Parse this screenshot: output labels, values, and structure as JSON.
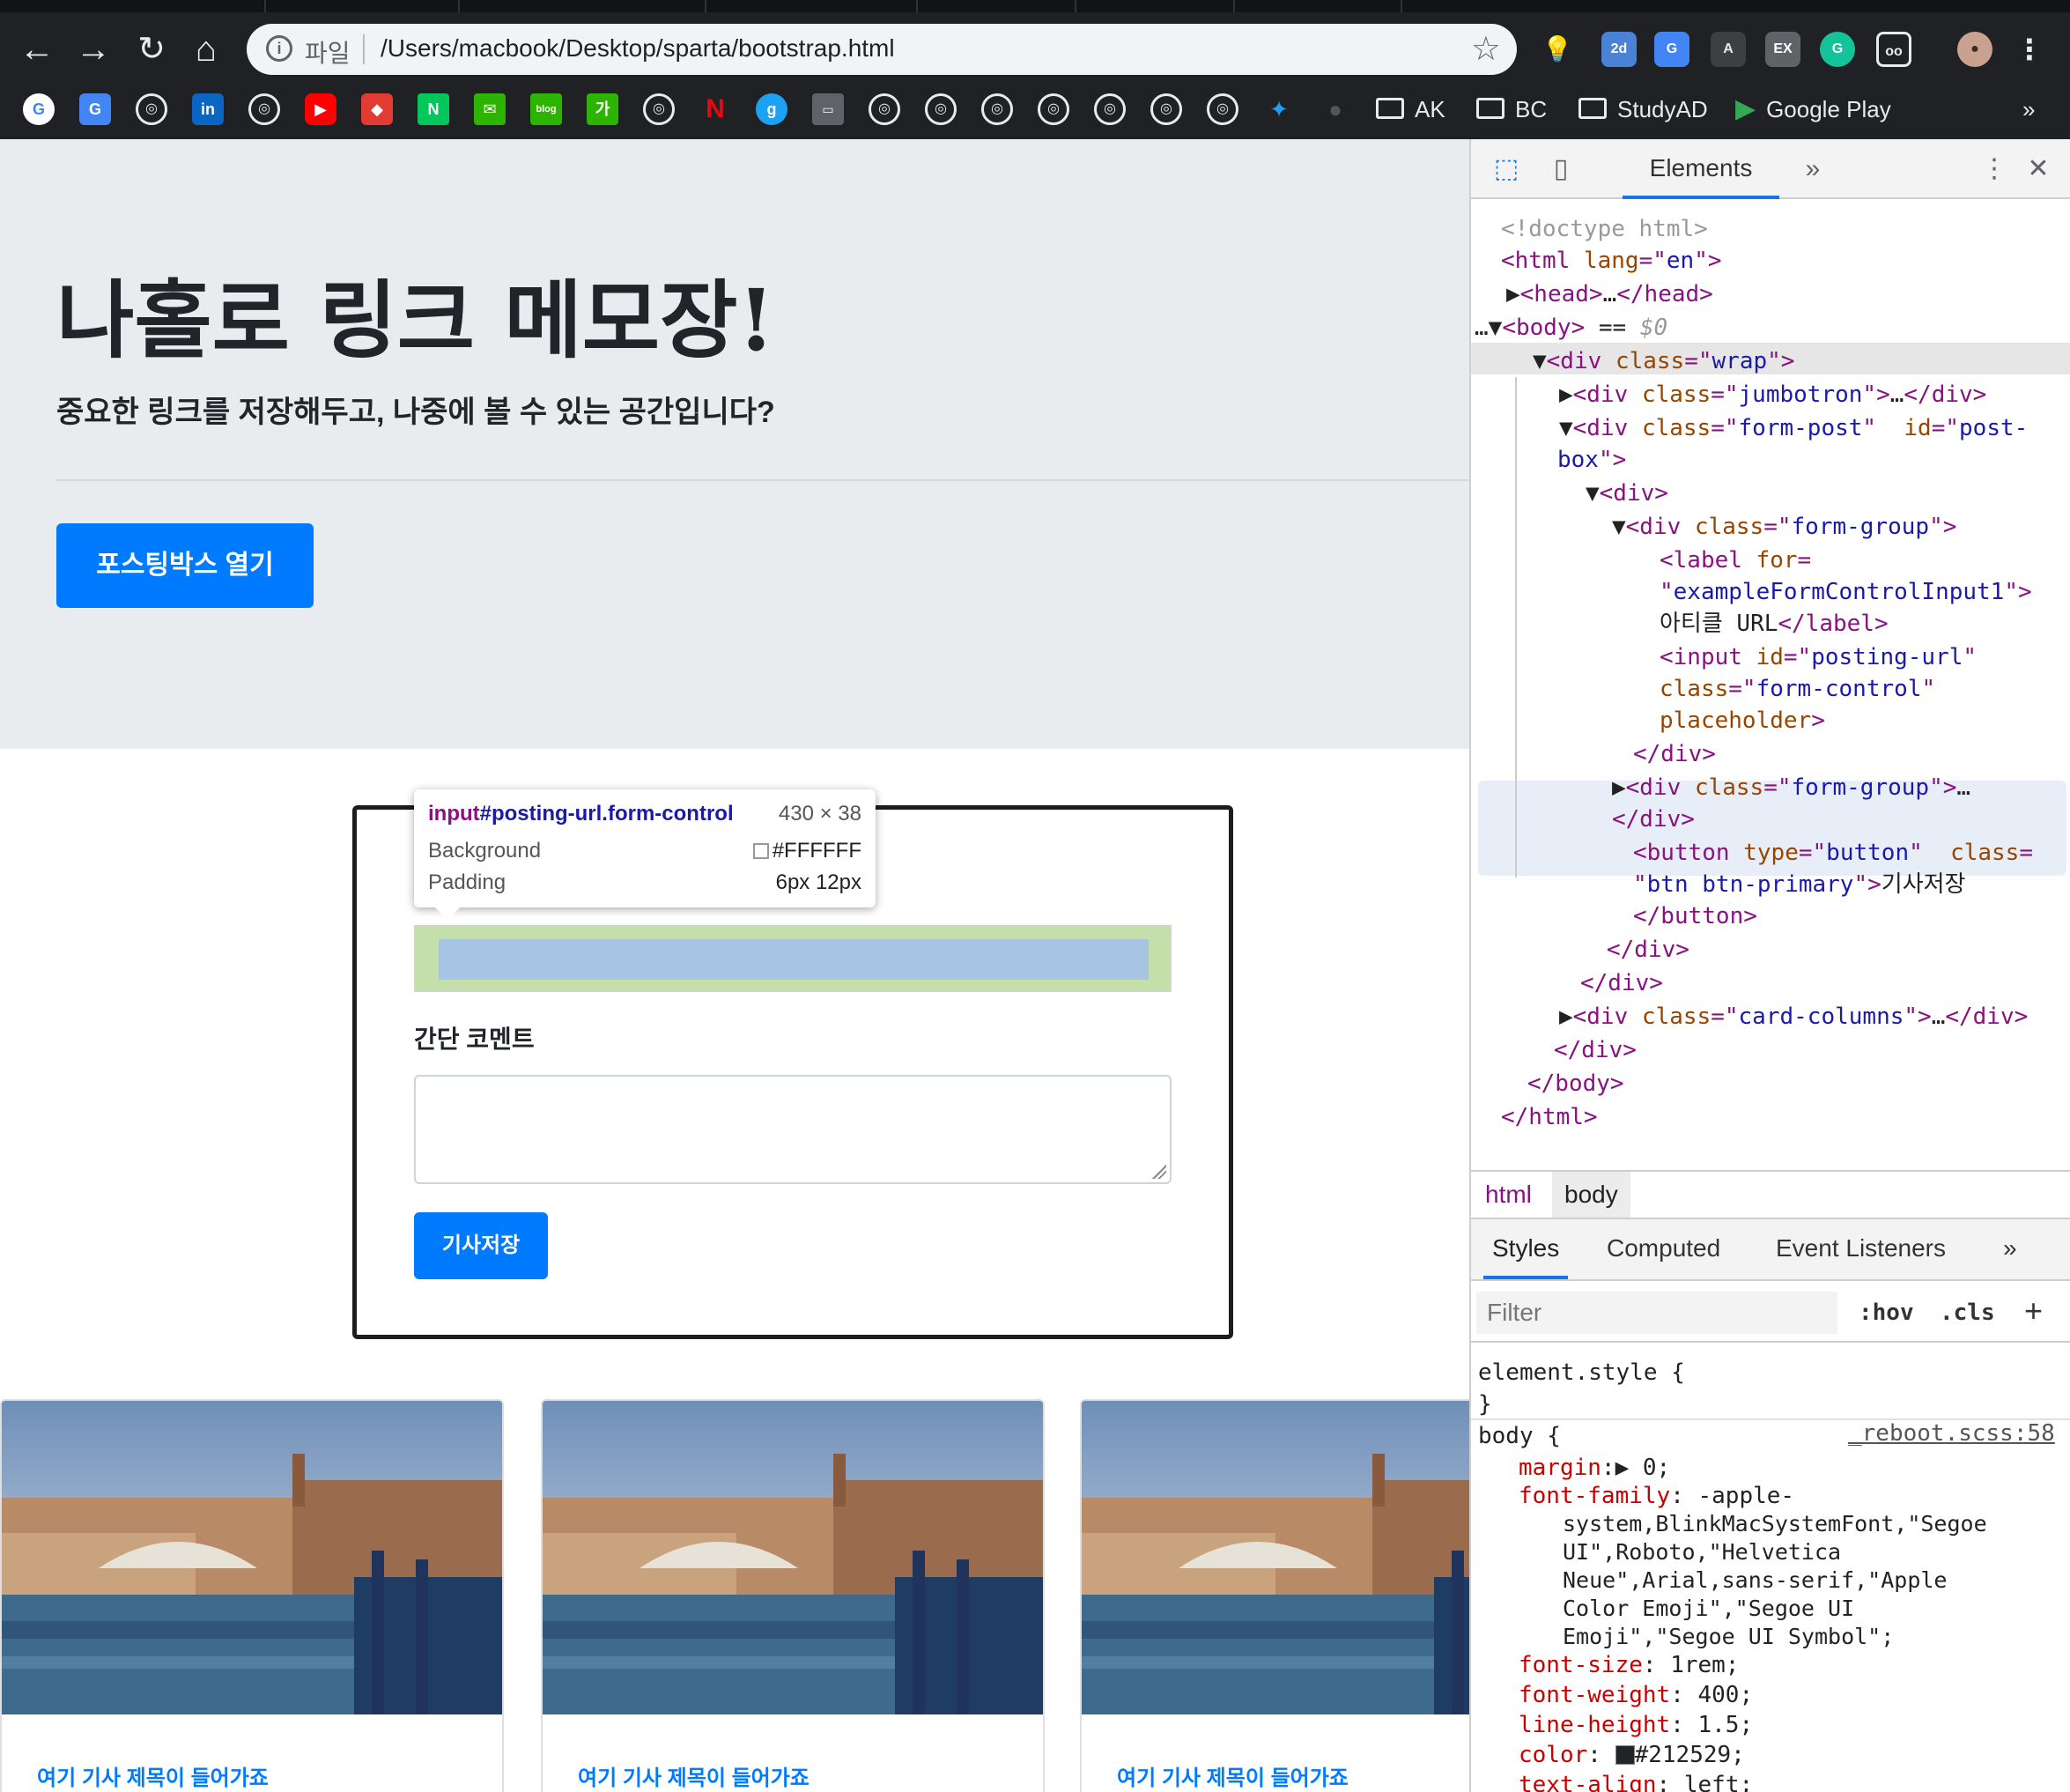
{
  "browser": {
    "omnibox": {
      "scheme_label": "파일",
      "url": "/Users/macbook/Desktop/sparta/bootstrap.html"
    },
    "bookmark_folders": [
      "AK",
      "BC",
      "StudyAD"
    ],
    "bookmark_link": "Google Play",
    "more_bookmarks": "»"
  },
  "page": {
    "heading": "나홀로 링크 메모장!",
    "lead": "중요한 링크를 저장해두고, 나중에 볼 수 있는 공간입니다?",
    "open_button": "포스팅박스 열기",
    "form": {
      "comment_label": "간단 코멘트",
      "save_button": "기사저장"
    },
    "tooltip": {
      "tag": "input",
      "id_class": "#posting-url.form-control",
      "size": "430 × 38",
      "rows": [
        {
          "key": "Background",
          "value": "#FFFFFF"
        },
        {
          "key": "Padding",
          "value": "6px 12px"
        }
      ]
    },
    "cards": [
      {
        "title": "여기 기사 제목이 들어가죠"
      },
      {
        "title": "여기 기사 제목이 들어가죠"
      },
      {
        "title": "여기 기사 제목이 들어가죠"
      }
    ]
  },
  "devtools": {
    "active_tab": "Elements",
    "more": "»",
    "breadcrumbs": [
      "html",
      "body"
    ],
    "subtabs": [
      "Styles",
      "Computed",
      "Event Listeners",
      "»"
    ],
    "filter_placeholder": "Filter",
    "hov": ":hov",
    "cls": ".cls",
    "plus": "+",
    "source_link": "_reboot.scss:58",
    "label_text": "아티클 URL",
    "button_text": "기사저장"
  },
  "colors": {
    "chrome_bg": "#202124",
    "jumbotron_bg": "#e9ecef",
    "primary": "#007bff",
    "highlight_padding": "#c5dfaa",
    "highlight_content": "#a7c4e5",
    "text": "#212529"
  }
}
